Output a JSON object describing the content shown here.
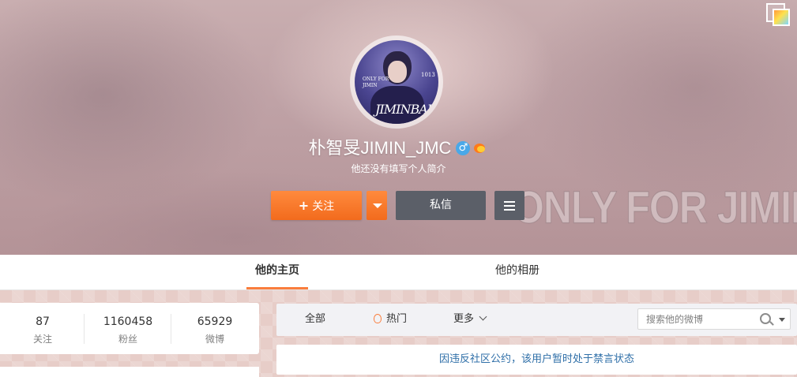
{
  "cover": {
    "watermark": "ONLY FOR JIMIN",
    "avatar_text_left": "ONLY FOR JIMIN",
    "avatar_text_right": "1013",
    "avatar_signature": "JIMINBAR"
  },
  "profile": {
    "username": "朴智旻JIMIN_JMC",
    "gender_icon": "♂",
    "bio": "他还没有填写个人简介"
  },
  "actions": {
    "follow_label": "关注",
    "follow_plus": "+",
    "message_label": "私信"
  },
  "tabs": [
    {
      "label": "他的主页",
      "active": true
    },
    {
      "label": "他的相册",
      "active": false
    }
  ],
  "stats": [
    {
      "value": "87",
      "label": "关注"
    },
    {
      "value": "1160458",
      "label": "粉丝"
    },
    {
      "value": "65929",
      "label": "微博"
    }
  ],
  "filter": {
    "all_label": "全部",
    "hot_label": "热门",
    "more_label": "更多",
    "search_placeholder": "搜索他的微博"
  },
  "notice": "因违反社区公约，该用户暂时处于禁言状态",
  "colors": {
    "accent": "#fa7d3c",
    "follow_button": "#f26b1d",
    "dark_button": "#5b5f68",
    "notice_text": "#2f6fa8"
  }
}
